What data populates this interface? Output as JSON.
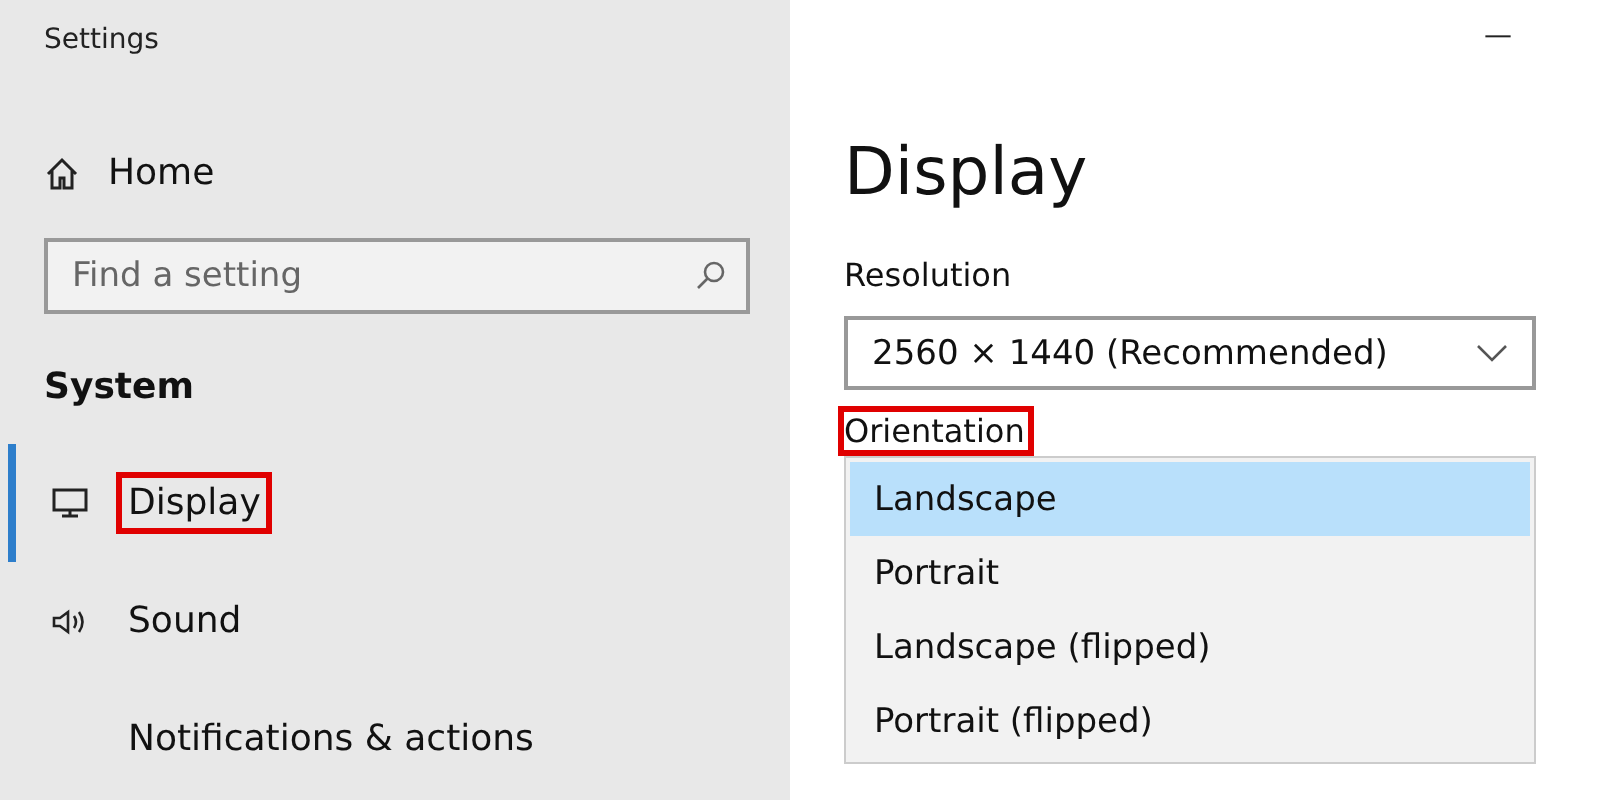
{
  "window": {
    "title": "Settings",
    "minimize": "—"
  },
  "sidebar": {
    "home": "Home",
    "search": {
      "placeholder": "Find a setting"
    },
    "section": "System",
    "items": [
      {
        "label": "Display",
        "kind": "monitor",
        "selected": true,
        "highlighted": true
      },
      {
        "label": "Sound",
        "kind": "sound",
        "selected": false,
        "highlighted": false
      },
      {
        "label": "Notifications & actions",
        "kind": "blank",
        "selected": false,
        "highlighted": false
      }
    ]
  },
  "content": {
    "title": "Display",
    "resolution": {
      "label": "Resolution",
      "value": "2560 × 1440 (Recommended)"
    },
    "orientation": {
      "label": "Orientation",
      "highlighted": true,
      "options": [
        {
          "label": "Landscape",
          "selected": true
        },
        {
          "label": "Portrait",
          "selected": false
        },
        {
          "label": "Landscape (flipped)",
          "selected": false
        },
        {
          "label": "Portrait (flipped)",
          "selected": false
        }
      ]
    }
  }
}
